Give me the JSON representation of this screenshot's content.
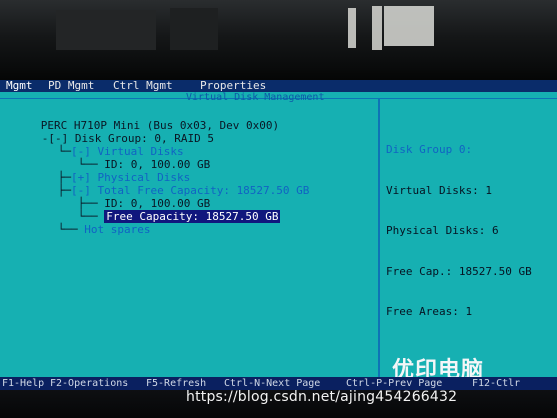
{
  "menu": {
    "tabs": [
      {
        "label": "Mgmt"
      },
      {
        "label": "PD Mgmt"
      },
      {
        "label": "Ctrl Mgmt"
      },
      {
        "label": "Properties"
      }
    ]
  },
  "panel_title": "Virtual Disk Management",
  "tree": {
    "controller": "PERC H710P Mini (Bus 0x03, Dev 0x00)",
    "disk_group": "[-] Disk Group: 0, RAID 5",
    "virtual_disks": "[-] Virtual Disks",
    "vd_id": "ID: 0, 100.00 GB",
    "physical_disks": "[+] Physical Disks",
    "total_free": "[-] Total Free Capacity: 18527.50 GB",
    "free_id": "ID: 0, 100.00 GB",
    "free_capacity": "Free Capacity: 18527.50 GB",
    "hot_spares": "Hot spares"
  },
  "details": {
    "header": "Disk Group 0:",
    "virtual_disks": "Virtual Disks: 1",
    "physical_disks": "Physical Disks: 6",
    "free_cap": "Free Cap.: 18527.50 GB",
    "free_areas": "Free Areas: 1"
  },
  "statusbar": {
    "help": "F1-Help",
    "operations": "F2-Operations",
    "refresh": "F5-Refresh",
    "next_page": "Ctrl-N-Next Page",
    "prev_page": "Ctrl-P-Prev Page",
    "ctrl": "F12-Ctlr"
  },
  "watermark": {
    "brand": "优印电脑",
    "url": "https://blog.csdn.net/ajing454266432"
  },
  "colors": {
    "screen": "#16b0b2",
    "menubar": "#0a2c6a",
    "selection": "#10177d",
    "tree_text": "#1163c3"
  }
}
